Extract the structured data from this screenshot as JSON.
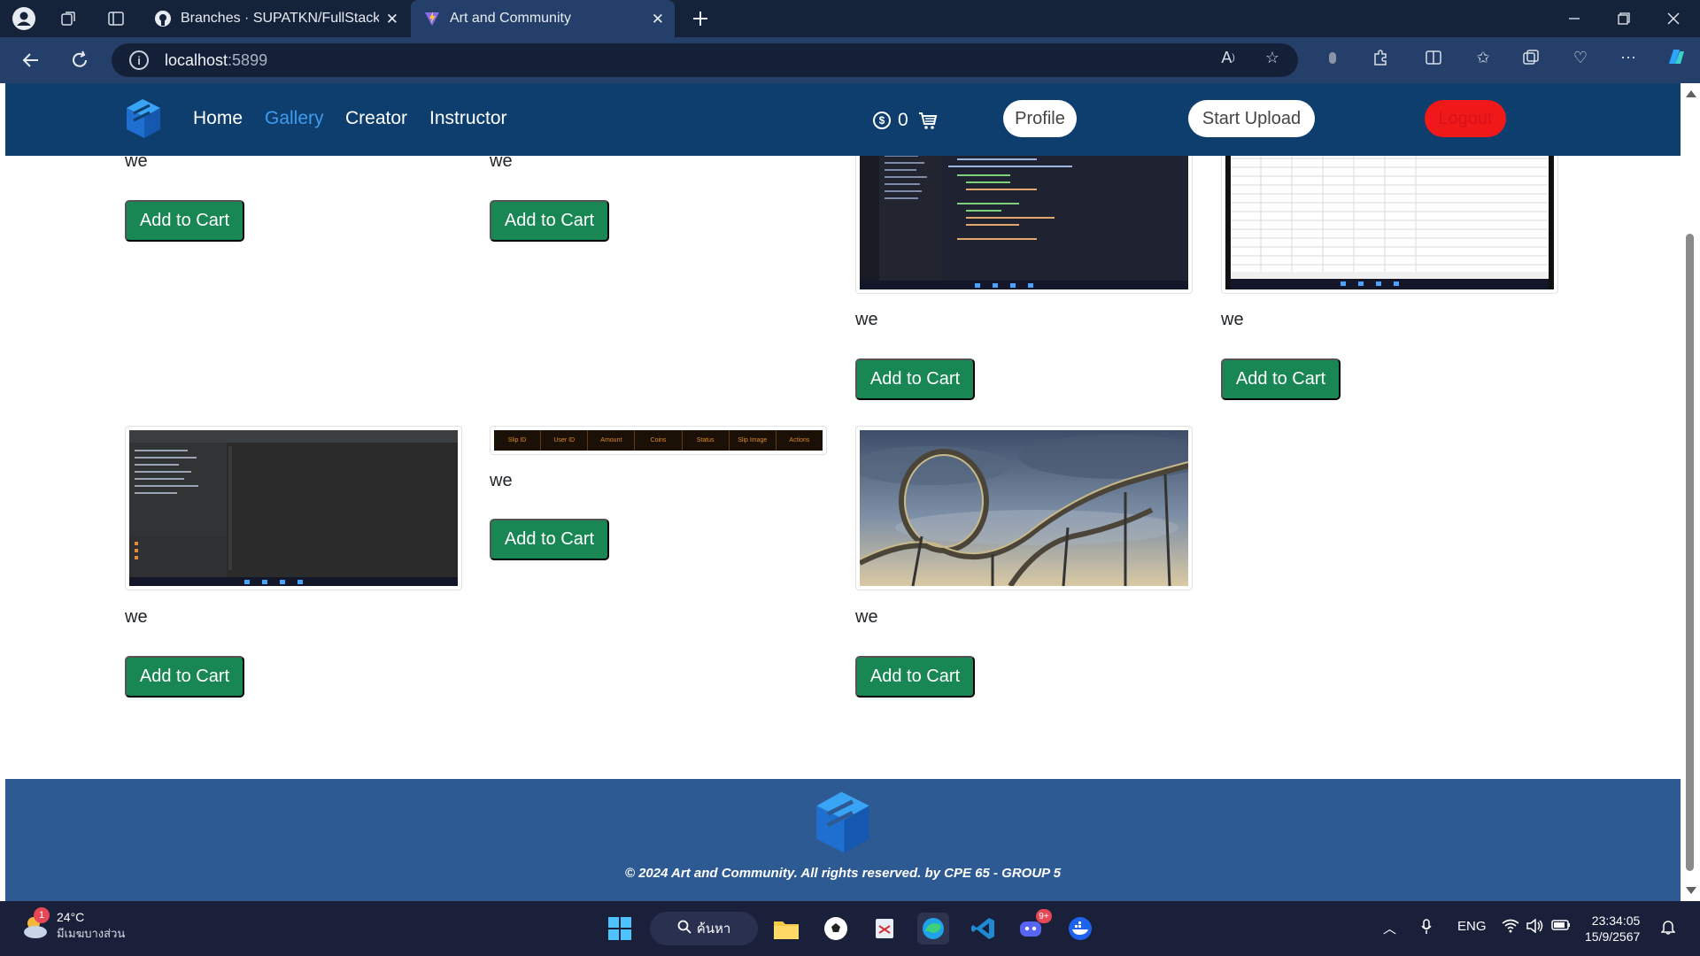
{
  "browser": {
    "tabs": [
      {
        "title": "Branches · SUPATKN/FullStack_Pro",
        "icon": "github-icon"
      },
      {
        "title": "Art and Community",
        "icon": "vite-icon"
      }
    ],
    "url_host": "localhost",
    "url_port": ":5899"
  },
  "site": {
    "nav": {
      "home": "Home",
      "gallery": "Gallery",
      "creator": "Creator",
      "instructor": "Instructor"
    },
    "coins": "0",
    "profile": "Profile",
    "start_upload": "Start Upload",
    "logout": "Logout"
  },
  "gallery": {
    "items": [
      {
        "caption": "we",
        "button": "Add to Cart",
        "image": "none"
      },
      {
        "caption": "we",
        "button": "Add to Cart",
        "image": "none"
      },
      {
        "caption": "we",
        "button": "Add to Cart",
        "image": "code-editor-screenshot"
      },
      {
        "caption": "we",
        "button": "Add to Cart",
        "image": "spreadsheet-screenshot"
      },
      {
        "caption": "we",
        "button": "Add to Cart",
        "image": "ide-screenshot"
      },
      {
        "caption": "we",
        "button": "Add to Cart",
        "image": "table-header-screenshot",
        "table_headers": [
          "Slip ID",
          "User ID",
          "Amount",
          "Coins",
          "Status",
          "Slip Image",
          "Actions"
        ]
      },
      {
        "caption": "we",
        "button": "Add to Cart",
        "image": "roller-coaster-photo"
      }
    ]
  },
  "footer": {
    "copyright": "© 2024 Art and Community. All rights reserved. by CPE 65 - GROUP 5"
  },
  "taskbar": {
    "weather_badge": "1",
    "temperature": "24°C",
    "condition": "มีเมฆบางส่วน",
    "search": "ค้นหา",
    "discord_badge": "9+",
    "language": "ENG",
    "time": "23:34:05",
    "date": "15/9/2567"
  },
  "colors": {
    "nav_bg": "#0e3e6e",
    "active_link": "#3d9bf0",
    "cart_button": "#198754",
    "logout": "#f01818",
    "footer_bg": "#2e5a93"
  }
}
